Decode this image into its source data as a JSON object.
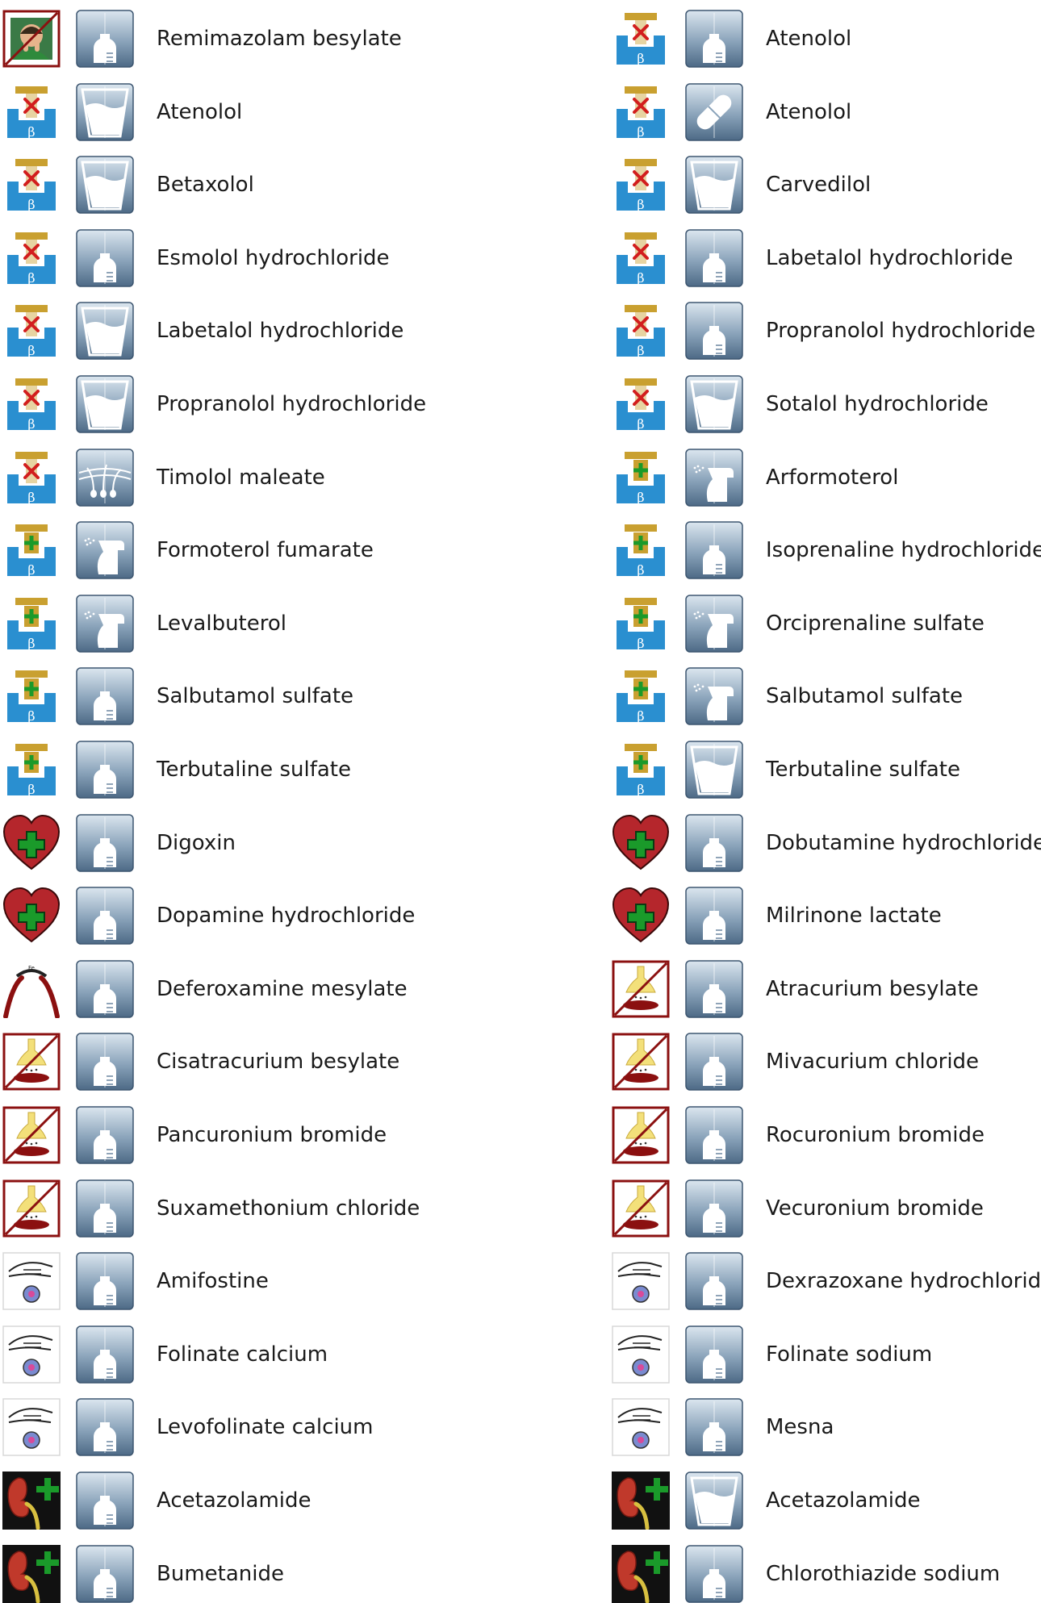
{
  "rows": [
    {
      "left": {
        "class_icon": "sedation-face-icon",
        "form_icon": "vial-icon",
        "label": "Remimazolam besylate"
      },
      "right": {
        "class_icon": "beta-blocker-icon",
        "form_icon": "vial-icon",
        "label": "Atenolol"
      }
    },
    {
      "left": {
        "class_icon": "beta-blocker-icon",
        "form_icon": "oral-liquid-icon",
        "label": "Atenolol"
      },
      "right": {
        "class_icon": "beta-blocker-icon",
        "form_icon": "capsule-icon",
        "label": "Atenolol"
      }
    },
    {
      "left": {
        "class_icon": "beta-blocker-icon",
        "form_icon": "oral-liquid-icon",
        "label": "Betaxolol"
      },
      "right": {
        "class_icon": "beta-blocker-icon",
        "form_icon": "oral-liquid-icon",
        "label": "Carvedilol"
      }
    },
    {
      "left": {
        "class_icon": "beta-blocker-icon",
        "form_icon": "vial-icon",
        "label": "Esmolol hydrochloride"
      },
      "right": {
        "class_icon": "beta-blocker-icon",
        "form_icon": "vial-icon",
        "label": "Labetalol hydrochloride"
      }
    },
    {
      "left": {
        "class_icon": "beta-blocker-icon",
        "form_icon": "oral-liquid-icon",
        "label": "Labetalol hydrochloride"
      },
      "right": {
        "class_icon": "beta-blocker-icon",
        "form_icon": "vial-icon",
        "label": "Propranolol hydrochloride"
      }
    },
    {
      "left": {
        "class_icon": "beta-blocker-icon",
        "form_icon": "oral-liquid-icon",
        "label": "Propranolol hydrochloride"
      },
      "right": {
        "class_icon": "beta-blocker-icon",
        "form_icon": "oral-liquid-icon",
        "label": "Sotalol hydrochloride"
      }
    },
    {
      "left": {
        "class_icon": "beta-blocker-icon",
        "form_icon": "topical-hair-icon",
        "label": "Timolol maleate"
      },
      "right": {
        "class_icon": "beta-agonist-icon",
        "form_icon": "inhaler-icon",
        "label": "Arformoterol"
      }
    },
    {
      "left": {
        "class_icon": "beta-agonist-icon",
        "form_icon": "inhaler-icon",
        "label": "Formoterol fumarate"
      },
      "right": {
        "class_icon": "beta-agonist-icon",
        "form_icon": "vial-icon",
        "label": "Isoprenaline hydrochloride"
      }
    },
    {
      "left": {
        "class_icon": "beta-agonist-icon",
        "form_icon": "inhaler-icon",
        "label": "Levalbuterol"
      },
      "right": {
        "class_icon": "beta-agonist-icon",
        "form_icon": "inhaler-icon",
        "label": "Orciprenaline sulfate"
      }
    },
    {
      "left": {
        "class_icon": "beta-agonist-icon",
        "form_icon": "vial-icon",
        "label": "Salbutamol sulfate"
      },
      "right": {
        "class_icon": "beta-agonist-icon",
        "form_icon": "inhaler-icon",
        "label": "Salbutamol sulfate"
      }
    },
    {
      "left": {
        "class_icon": "beta-agonist-icon",
        "form_icon": "vial-icon",
        "label": "Terbutaline sulfate"
      },
      "right": {
        "class_icon": "beta-agonist-icon",
        "form_icon": "oral-liquid-icon",
        "label": "Terbutaline sulfate"
      }
    },
    {
      "left": {
        "class_icon": "heart-plus-icon",
        "form_icon": "vial-icon",
        "label": "Digoxin"
      },
      "right": {
        "class_icon": "heart-plus-icon",
        "form_icon": "vial-icon",
        "label": "Dobutamine hydrochloride"
      }
    },
    {
      "left": {
        "class_icon": "heart-plus-icon",
        "form_icon": "vial-icon",
        "label": "Dopamine hydrochloride"
      },
      "right": {
        "class_icon": "heart-plus-icon",
        "form_icon": "vial-icon",
        "label": "Milrinone lactate"
      }
    },
    {
      "left": {
        "class_icon": "chelator-pliers-icon",
        "form_icon": "vial-icon",
        "label": "Deferoxamine mesylate"
      },
      "right": {
        "class_icon": "neuromuscular-blocker-icon",
        "form_icon": "vial-icon",
        "label": "Atracurium besylate"
      }
    },
    {
      "left": {
        "class_icon": "neuromuscular-blocker-icon",
        "form_icon": "vial-icon",
        "label": "Cisatracurium besylate"
      },
      "right": {
        "class_icon": "neuromuscular-blocker-icon",
        "form_icon": "vial-icon",
        "label": "Mivacurium chloride"
      }
    },
    {
      "left": {
        "class_icon": "neuromuscular-blocker-icon",
        "form_icon": "vial-icon",
        "label": "Pancuronium bromide"
      },
      "right": {
        "class_icon": "neuromuscular-blocker-icon",
        "form_icon": "vial-icon",
        "label": "Rocuronium bromide"
      }
    },
    {
      "left": {
        "class_icon": "neuromuscular-blocker-icon",
        "form_icon": "vial-icon",
        "label": "Suxamethonium chloride"
      },
      "right": {
        "class_icon": "neuromuscular-blocker-icon",
        "form_icon": "vial-icon",
        "label": "Vecuronium bromide"
      }
    },
    {
      "left": {
        "class_icon": "protective-hand-icon",
        "form_icon": "vial-icon",
        "label": "Amifostine"
      },
      "right": {
        "class_icon": "protective-hand-icon",
        "form_icon": "vial-icon",
        "label": "Dexrazoxane hydrochloride"
      }
    },
    {
      "left": {
        "class_icon": "protective-hand-icon",
        "form_icon": "vial-icon",
        "label": "Folinate calcium"
      },
      "right": {
        "class_icon": "protective-hand-icon",
        "form_icon": "vial-icon",
        "label": "Folinate sodium"
      }
    },
    {
      "left": {
        "class_icon": "protective-hand-icon",
        "form_icon": "vial-icon",
        "label": "Levofolinate calcium"
      },
      "right": {
        "class_icon": "protective-hand-icon",
        "form_icon": "vial-icon",
        "label": "Mesna"
      }
    },
    {
      "left": {
        "class_icon": "kidney-diuretic-icon",
        "form_icon": "vial-icon",
        "label": "Acetazolamide"
      },
      "right": {
        "class_icon": "kidney-diuretic-icon",
        "form_icon": "oral-liquid-icon",
        "label": "Acetazolamide"
      }
    },
    {
      "left": {
        "class_icon": "kidney-diuretic-icon",
        "form_icon": "vial-icon",
        "label": "Bumetanide"
      },
      "right": {
        "class_icon": "kidney-diuretic-icon",
        "form_icon": "vial-icon",
        "label": "Chlorothiazide sodium"
      }
    }
  ],
  "colors": {
    "beta_blue": "#2a8fd0",
    "beta_gold": "#c9a030",
    "block_red": "#d21e1e",
    "agonist_green": "#1a9a2a",
    "heart_red": "#b5262c",
    "nmb_dark_red": "#8b1010",
    "form_tile_top": "#dbe6ef",
    "form_tile_bottom": "#4d6a86"
  }
}
